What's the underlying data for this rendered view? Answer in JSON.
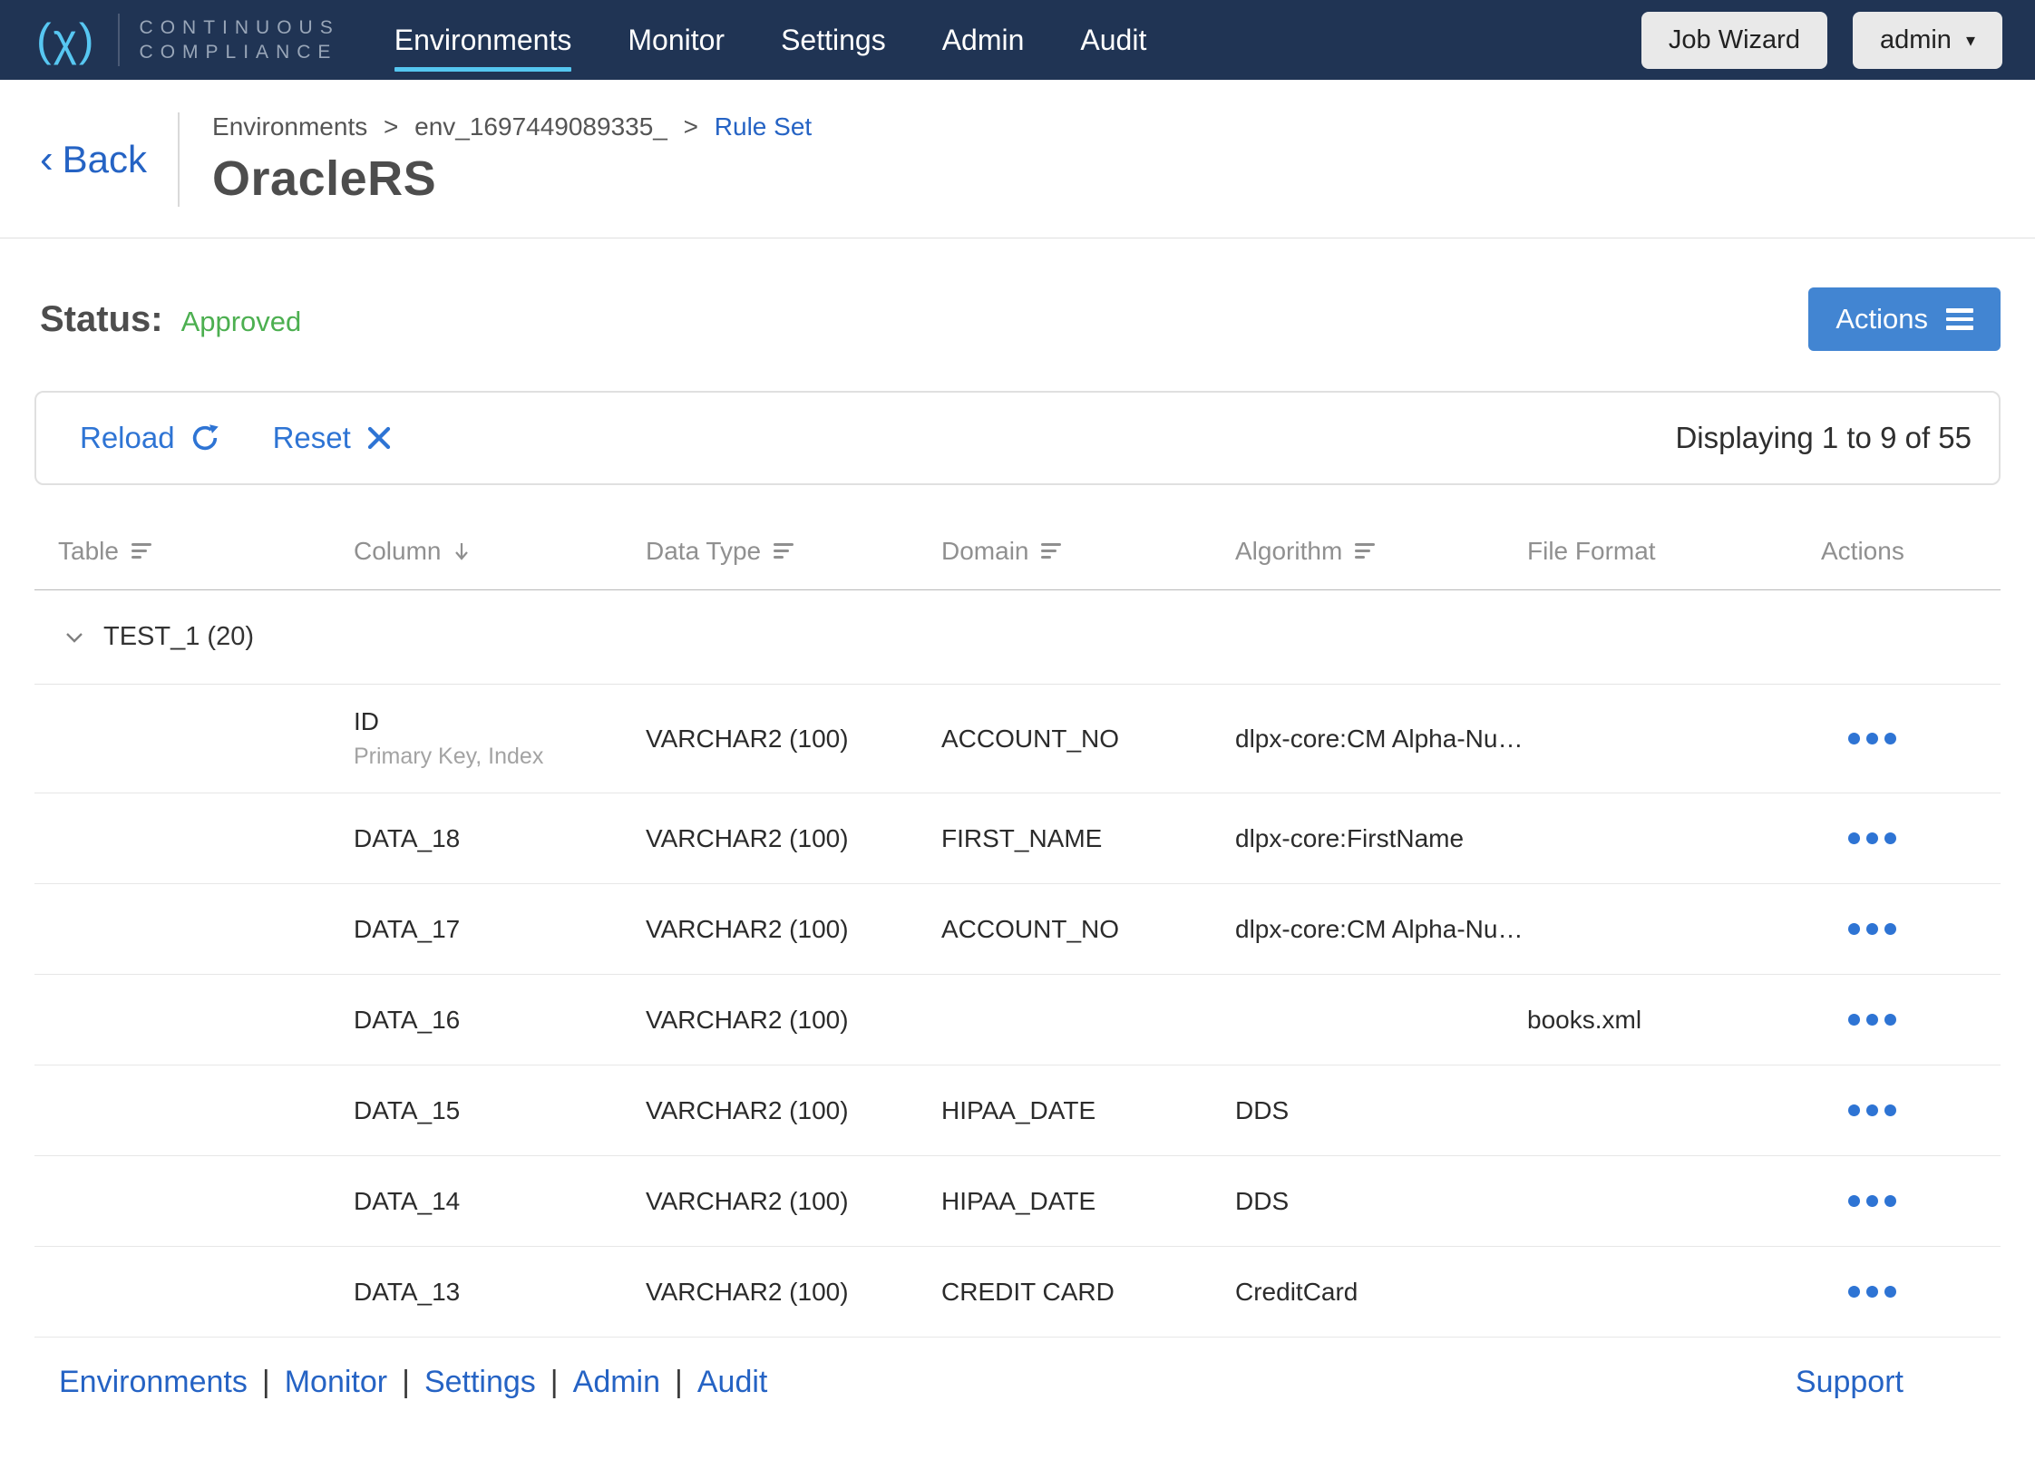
{
  "navbar": {
    "logo_mark": "(χ)",
    "wordmark_line1": "CONTINUOUS",
    "wordmark_line2": "COMPLIANCE",
    "items": [
      {
        "label": "Environments",
        "active": true
      },
      {
        "label": "Monitor",
        "active": false
      },
      {
        "label": "Settings",
        "active": false
      },
      {
        "label": "Admin",
        "active": false
      },
      {
        "label": "Audit",
        "active": false
      }
    ],
    "job_wizard_label": "Job Wizard",
    "user_label": "admin"
  },
  "icons": {
    "back_chevron": "‹",
    "caret_down": "▾"
  },
  "colors": {
    "navbar_bg": "#203454",
    "accent_light_blue": "#55c6f0",
    "link_blue": "#2563c4",
    "button_blue": "#4285d2",
    "status_green": "#4caf50"
  },
  "header": {
    "back_label": "Back",
    "breadcrumb": {
      "crumb1": "Environments",
      "crumb2": "env_1697449089335_",
      "separator": ">",
      "current_link": "Rule Set"
    },
    "title": "OracleRS"
  },
  "status": {
    "label": "Status:",
    "value": "Approved"
  },
  "actions_button_label": "Actions",
  "toolbar": {
    "reload_label": "Reload",
    "reset_label": "Reset",
    "displaying": "Displaying 1 to 9 of 55"
  },
  "table": {
    "columns": [
      {
        "label": "Table"
      },
      {
        "label": "Column"
      },
      {
        "label": "Data Type"
      },
      {
        "label": "Domain"
      },
      {
        "label": "Algorithm"
      },
      {
        "label": "File Format"
      },
      {
        "label": "Actions"
      }
    ],
    "group_label": "TEST_1 (20)",
    "rows": [
      {
        "column": "ID",
        "note": "Primary Key, Index",
        "data_type": "VARCHAR2 (100)",
        "domain": "ACCOUNT_NO",
        "algorithm": "dlpx-core:CM Alpha-Nu…",
        "file_format": ""
      },
      {
        "column": "DATA_18",
        "data_type": "VARCHAR2 (100)",
        "domain": "FIRST_NAME",
        "algorithm": "dlpx-core:FirstName",
        "file_format": ""
      },
      {
        "column": "DATA_17",
        "data_type": "VARCHAR2 (100)",
        "domain": "ACCOUNT_NO",
        "algorithm": "dlpx-core:CM Alpha-Nu…",
        "file_format": ""
      },
      {
        "column": "DATA_16",
        "data_type": "VARCHAR2 (100)",
        "domain": "",
        "algorithm": "",
        "file_format": "books.xml"
      },
      {
        "column": "DATA_15",
        "data_type": "VARCHAR2 (100)",
        "domain": "HIPAA_DATE",
        "algorithm": "DDS",
        "file_format": ""
      },
      {
        "column": "DATA_14",
        "data_type": "VARCHAR2 (100)",
        "domain": "HIPAA_DATE",
        "algorithm": "DDS",
        "file_format": ""
      },
      {
        "column": "DATA_13",
        "data_type": "VARCHAR2 (100)",
        "domain": "CREDIT CARD",
        "algorithm": "CreditCard",
        "file_format": ""
      }
    ]
  },
  "footer": {
    "links": [
      "Environments",
      "Monitor",
      "Settings",
      "Admin",
      "Audit"
    ],
    "separator": "|",
    "support_label": "Support"
  }
}
